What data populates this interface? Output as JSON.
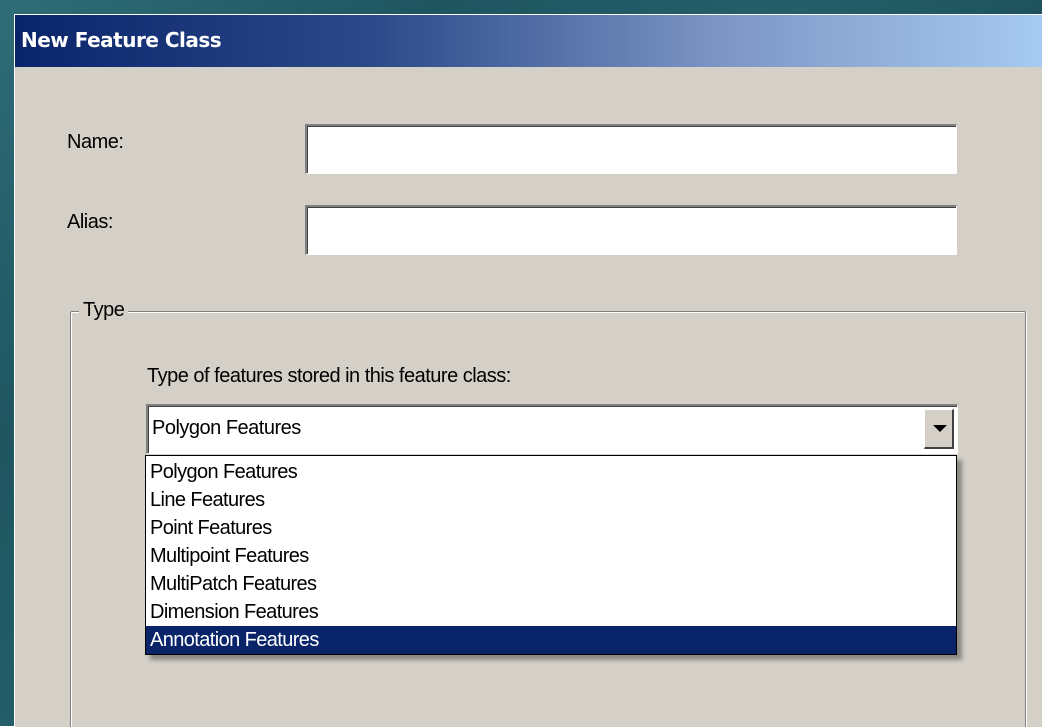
{
  "window": {
    "title": "New Feature Class"
  },
  "form": {
    "name_label": "Name:",
    "name_value": "",
    "alias_label": "Alias:",
    "alias_value": ""
  },
  "type_group": {
    "legend": "Type",
    "description": "Type of features stored in this feature class:",
    "selected_value": "Polygon Features",
    "options": [
      "Polygon Features",
      "Line Features",
      "Point Features",
      "Multipoint Features",
      "MultiPatch Features",
      "Dimension Features",
      "Annotation Features"
    ],
    "highlighted_option": "Annotation Features"
  },
  "colors": {
    "dialog_face": "#d4d0c8",
    "titlebar_start": "#0a246a",
    "titlebar_end": "#a6caf0",
    "highlight": "#0a246a"
  },
  "icons": {
    "combo_button": "chevron-down-icon"
  }
}
